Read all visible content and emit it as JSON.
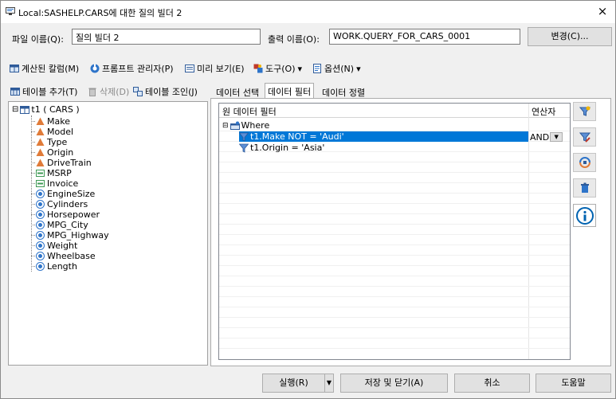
{
  "window": {
    "title": "Local:SASHELP.CARS에 대한 질의 빌더 2",
    "close_glyph": "×"
  },
  "names": {
    "file_label": "파일 이름(Q):",
    "file_value": "질의 빌더 2",
    "output_label": "출력 이름(O):",
    "output_value": "WORK.QUERY_FOR_CARS_0001",
    "change_button": "변경(C)..."
  },
  "toolbar": {
    "computed": "계산된 칼럼(M)",
    "prompt": "프롬프트 관리자(P)",
    "preview": "미리 보기(E)",
    "tools": "도구(O)",
    "options": "옵션(N)",
    "dropdown_glyph": "▾"
  },
  "left_toolbar": {
    "add_table": "테이블 추가(T)",
    "delete": "삭제(D)",
    "join": "테이블 조인(J)"
  },
  "tree": {
    "root": "t1 ( CARS )",
    "expander": "⊟",
    "columns": [
      {
        "name": "Make",
        "type": "char"
      },
      {
        "name": "Model",
        "type": "char"
      },
      {
        "name": "Type",
        "type": "char"
      },
      {
        "name": "Origin",
        "type": "char"
      },
      {
        "name": "DriveTrain",
        "type": "char"
      },
      {
        "name": "MSRP",
        "type": "currency"
      },
      {
        "name": "Invoice",
        "type": "currency"
      },
      {
        "name": "EngineSize",
        "type": "num"
      },
      {
        "name": "Cylinders",
        "type": "num"
      },
      {
        "name": "Horsepower",
        "type": "num"
      },
      {
        "name": "MPG_City",
        "type": "num"
      },
      {
        "name": "MPG_Highway",
        "type": "num"
      },
      {
        "name": "Weight",
        "type": "num"
      },
      {
        "name": "Wheelbase",
        "type": "num"
      },
      {
        "name": "Length",
        "type": "num"
      }
    ]
  },
  "tabs": [
    "데이터 선택",
    "데이터 필터",
    "데이터 정렬"
  ],
  "filter": {
    "header_raw": "원 데이터 필터",
    "header_op": "연산자",
    "where": "Where",
    "expander": "⊟",
    "conditions": [
      {
        "text": "t1.Make NOT = 'Audi'",
        "operator": "AND"
      },
      {
        "text": "t1.Origin = 'Asia'"
      }
    ],
    "combo_arrow": "▼"
  },
  "bottom": {
    "run": "실행(R)",
    "run_arrow": "▼",
    "save_close": "저장 및 닫기(A)",
    "cancel": "취소",
    "help": "도움말"
  },
  "colors": {
    "selection": "#0078d7",
    "char_icon": "#e07b39",
    "num_icon": "#2e74c9",
    "currency_icon": "#3f9a55",
    "accent": "#0063b1"
  }
}
